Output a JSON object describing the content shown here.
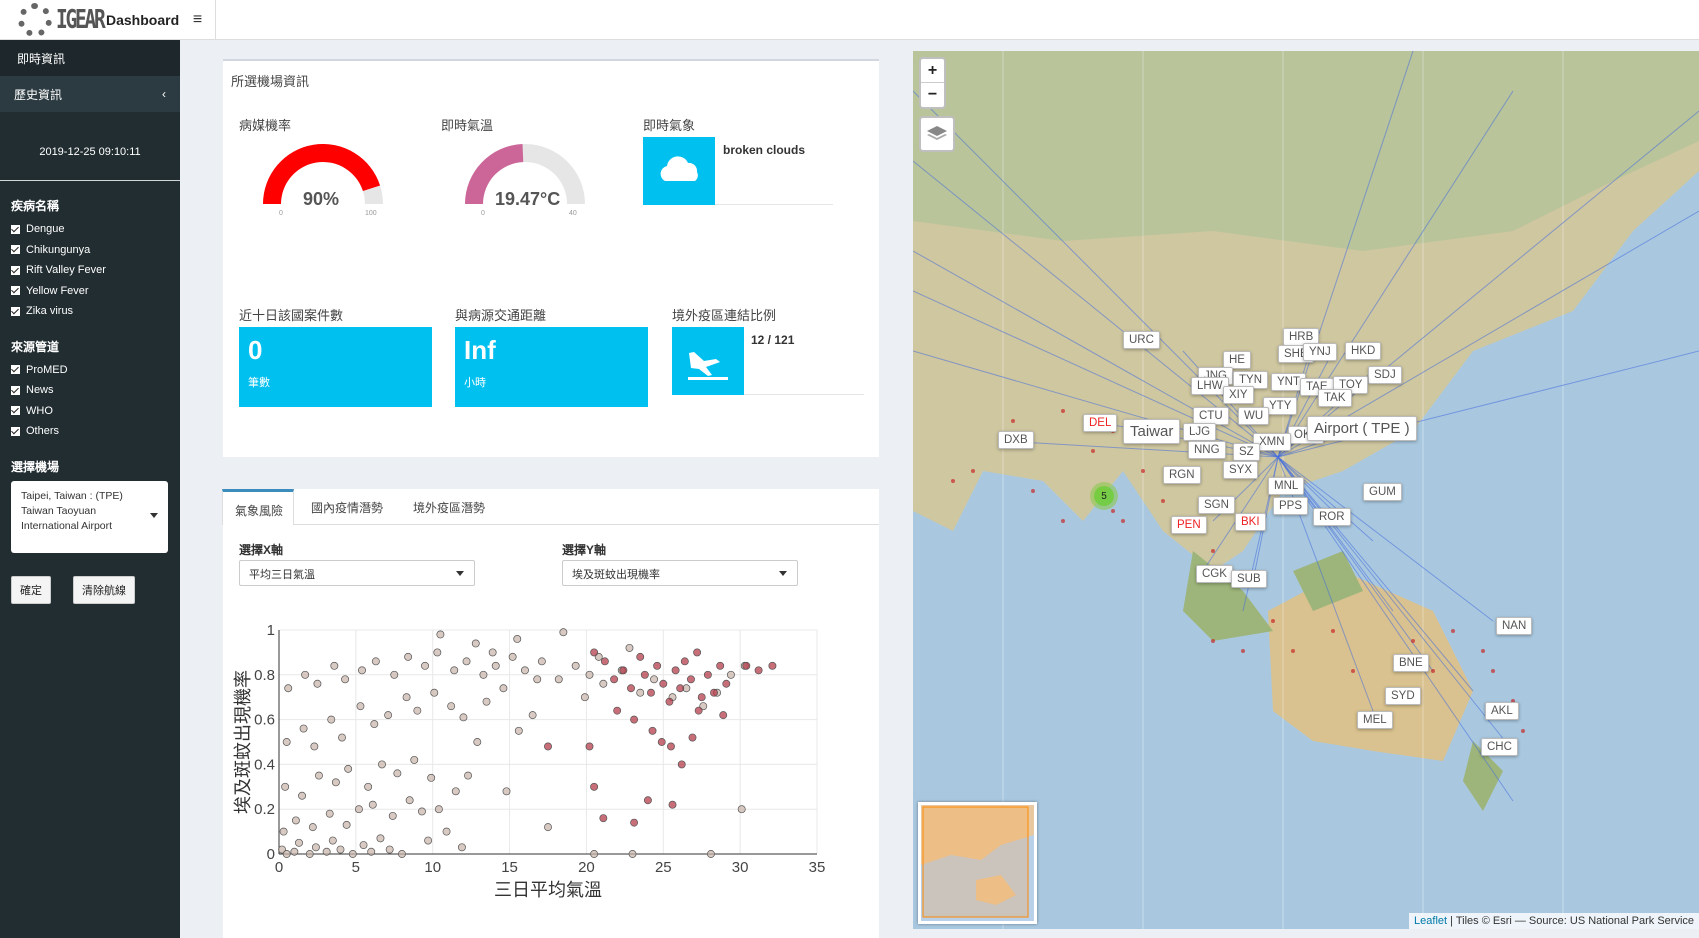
{
  "header": {
    "brand": "IGEAR",
    "title": "Dashboard",
    "menu_icon": "hamburger-icon"
  },
  "sidebar": {
    "nav": [
      {
        "label": "即時資訊"
      },
      {
        "label": "歷史資訊"
      }
    ],
    "datetime": "2019-12-25 09:10:11",
    "disease_title": "疾病名稱",
    "diseases": [
      "Dengue",
      "Chikungunya",
      "Rift Valley Fever",
      "Yellow Fever",
      "Zika virus"
    ],
    "source_title": "來源管道",
    "sources": [
      "ProMED",
      "News",
      "WHO",
      "Others"
    ],
    "airport_title": "選擇機場",
    "airport_value": "Taipei, Taiwan : (TPE) Taiwan Taoyuan International Airport",
    "confirm": "確定",
    "clear": "清除航線"
  },
  "info": {
    "title": "所選機場資訊",
    "prob_label": "病媒機率",
    "prob_value": "90%",
    "prob_fraction": 0.9,
    "prob_min": "0",
    "prob_max": "100",
    "temp_label": "即時氣溫",
    "temp_value": "19.47°C",
    "temp_fraction": 0.4868,
    "temp_min": "0",
    "temp_max": "40",
    "weather_label": "即時氣象",
    "weather_value": "broken clouds",
    "cases_label": "近十日該國案件數",
    "cases_value": "0",
    "cases_unit": "筆數",
    "distance_label": "與病源交通距離",
    "distance_value": "Inf",
    "distance_unit": "小時",
    "ratio_label": "境外疫區連結比例",
    "ratio_value": "12 / 121",
    "colors": {
      "gauge_red": "#ff0000",
      "gauge_pink": "#cc6699",
      "box": "#00c0ef"
    }
  },
  "tabs": [
    "氣象風險",
    "國內疫情潛勢",
    "境外疫區潛勢"
  ],
  "xaxis_label": "選擇X軸",
  "xaxis_value": "平均三日氣溫",
  "yaxis_label": "選擇Y軸",
  "yaxis_value": "埃及斑蚊出現機率",
  "chart_data": {
    "type": "scatter",
    "xlabel": "三日平均氣溫",
    "ylabel": "埃及斑蚊出現機率",
    "xlim": [
      0,
      35
    ],
    "ylim": [
      0,
      1
    ],
    "xticks": [
      "0",
      "5",
      "10",
      "15",
      "20",
      "25",
      "30",
      "35"
    ],
    "yticks": [
      "0",
      "0.2",
      "0.4",
      "0.6",
      "0.8",
      "1"
    ],
    "series": [
      {
        "color": "#c8b4a8",
        "points": [
          [
            0.2,
            0.02
          ],
          [
            0.5,
            0.0
          ],
          [
            1.0,
            0.01
          ],
          [
            1.3,
            0.05
          ],
          [
            2.0,
            0.0
          ],
          [
            2.4,
            0.03
          ],
          [
            3.1,
            0.01
          ],
          [
            3.5,
            0.06
          ],
          [
            4.0,
            0.02
          ],
          [
            4.8,
            0.0
          ],
          [
            5.5,
            0.04
          ],
          [
            6.0,
            0.01
          ],
          [
            6.6,
            0.07
          ],
          [
            7.2,
            0.02
          ],
          [
            8.0,
            0.0
          ],
          [
            0.3,
            0.1
          ],
          [
            1.1,
            0.15
          ],
          [
            2.2,
            0.12
          ],
          [
            3.3,
            0.18
          ],
          [
            4.4,
            0.13
          ],
          [
            5.2,
            0.2
          ],
          [
            6.1,
            0.22
          ],
          [
            7.4,
            0.17
          ],
          [
            8.5,
            0.24
          ],
          [
            9.3,
            0.19
          ],
          [
            0.4,
            0.3
          ],
          [
            1.5,
            0.26
          ],
          [
            2.6,
            0.35
          ],
          [
            3.7,
            0.32
          ],
          [
            4.5,
            0.38
          ],
          [
            5.8,
            0.3
          ],
          [
            6.7,
            0.4
          ],
          [
            7.7,
            0.36
          ],
          [
            8.8,
            0.42
          ],
          [
            9.9,
            0.34
          ],
          [
            10.4,
            0.2
          ],
          [
            11.5,
            0.28
          ],
          [
            12.3,
            0.35
          ],
          [
            0.5,
            0.5
          ],
          [
            1.6,
            0.56
          ],
          [
            2.3,
            0.48
          ],
          [
            3.4,
            0.6
          ],
          [
            4.1,
            0.52
          ],
          [
            5.3,
            0.66
          ],
          [
            6.2,
            0.58
          ],
          [
            7.1,
            0.62
          ],
          [
            8.3,
            0.7
          ],
          [
            9.0,
            0.64
          ],
          [
            10.1,
            0.72
          ],
          [
            11.2,
            0.66
          ],
          [
            12.0,
            0.61
          ],
          [
            13.5,
            0.68
          ],
          [
            14.6,
            0.74
          ],
          [
            0.6,
            0.74
          ],
          [
            1.7,
            0.8
          ],
          [
            2.5,
            0.76
          ],
          [
            3.6,
            0.84
          ],
          [
            4.3,
            0.78
          ],
          [
            5.4,
            0.82
          ],
          [
            6.3,
            0.86
          ],
          [
            7.5,
            0.8
          ],
          [
            8.4,
            0.88
          ],
          [
            9.5,
            0.84
          ],
          [
            10.3,
            0.9
          ],
          [
            11.4,
            0.82
          ],
          [
            12.2,
            0.86
          ],
          [
            13.3,
            0.8
          ],
          [
            14.1,
            0.84
          ],
          [
            15.2,
            0.88
          ],
          [
            16.0,
            0.82
          ],
          [
            17.1,
            0.86
          ],
          [
            18.2,
            0.78
          ],
          [
            19.3,
            0.84
          ],
          [
            20.2,
            0.8
          ],
          [
            21.1,
            0.76
          ],
          [
            22.3,
            0.82
          ],
          [
            23.5,
            0.72
          ],
          [
            24.4,
            0.78
          ],
          [
            25.6,
            0.7
          ],
          [
            26.5,
            0.74
          ],
          [
            27.6,
            0.66
          ],
          [
            28.5,
            0.72
          ],
          [
            29.4,
            0.8
          ],
          [
            30.3,
            0.84
          ],
          [
            15.5,
            0.96
          ],
          [
            10.5,
            0.98
          ],
          [
            18.5,
            0.99
          ],
          [
            12.8,
            0.94
          ],
          [
            13.9,
            0.9
          ],
          [
            16.8,
            0.78
          ],
          [
            19.9,
            0.7
          ],
          [
            20.8,
            0.88
          ],
          [
            22.8,
            0.92
          ],
          [
            17.5,
            0.12
          ],
          [
            10.9,
            0.1
          ],
          [
            14.8,
            0.28
          ],
          [
            12.9,
            0.5
          ],
          [
            15.6,
            0.55
          ],
          [
            16.5,
            0.62
          ],
          [
            9.7,
            0.06
          ],
          [
            11.9,
            0.03
          ],
          [
            20.5,
            0.0
          ],
          [
            23.0,
            0.0
          ],
          [
            28.1,
            0.0
          ],
          [
            30.1,
            0.2
          ]
        ]
      },
      {
        "color": "#b03040",
        "points": [
          [
            20.5,
            0.9
          ],
          [
            21.2,
            0.86
          ],
          [
            21.8,
            0.78
          ],
          [
            22.4,
            0.82
          ],
          [
            22.9,
            0.74
          ],
          [
            23.5,
            0.88
          ],
          [
            23.8,
            0.8
          ],
          [
            24.2,
            0.72
          ],
          [
            24.6,
            0.84
          ],
          [
            25.0,
            0.76
          ],
          [
            25.4,
            0.68
          ],
          [
            25.8,
            0.82
          ],
          [
            26.1,
            0.74
          ],
          [
            26.4,
            0.86
          ],
          [
            26.8,
            0.78
          ],
          [
            27.2,
            0.9
          ],
          [
            27.5,
            0.7
          ],
          [
            27.9,
            0.8
          ],
          [
            28.3,
            0.72
          ],
          [
            28.7,
            0.84
          ],
          [
            29.1,
            0.76
          ],
          [
            30.4,
            0.84
          ],
          [
            31.2,
            0.82
          ],
          [
            32.1,
            0.84
          ],
          [
            23.1,
            0.6
          ],
          [
            24.3,
            0.55
          ],
          [
            25.5,
            0.48
          ],
          [
            26.2,
            0.4
          ],
          [
            22.0,
            0.64
          ],
          [
            24.9,
            0.5
          ],
          [
            20.2,
            0.48
          ],
          [
            17.5,
            0.48
          ],
          [
            24.0,
            0.24
          ],
          [
            25.6,
            0.22
          ],
          [
            23.1,
            0.14
          ],
          [
            21.1,
            0.16
          ],
          [
            20.5,
            0.3
          ],
          [
            26.9,
            0.52
          ],
          [
            27.3,
            0.64
          ],
          [
            28.9,
            0.62
          ]
        ]
      }
    ]
  },
  "map": {
    "zoom_in": "+",
    "zoom_out": "−",
    "focus_label_left": "Taiwar",
    "focus_label_right": "Airport ( TPE )",
    "cluster_count": "5",
    "attribution_link": "Leaflet",
    "attribution_text": "| Tiles © Esri — Source: US National Park Service",
    "airports": [
      {
        "code": "URC",
        "red": false
      },
      {
        "code": "HRB",
        "red": false
      },
      {
        "code": "SHE",
        "red": false
      },
      {
        "code": "YNJ",
        "red": false
      },
      {
        "code": "HKD",
        "red": false
      },
      {
        "code": "SDJ",
        "red": false
      },
      {
        "code": "HE",
        "red": false
      },
      {
        "code": "JNG",
        "red": false
      },
      {
        "code": "TYN",
        "red": false
      },
      {
        "code": "YNT",
        "red": false
      },
      {
        "code": "TAE",
        "red": false
      },
      {
        "code": "TOY",
        "red": false
      },
      {
        "code": "LHW",
        "red": false
      },
      {
        "code": "XIY",
        "red": false
      },
      {
        "code": "TAK",
        "red": false
      },
      {
        "code": "YTY",
        "red": false
      },
      {
        "code": "CTU",
        "red": false
      },
      {
        "code": "WU",
        "red": false
      },
      {
        "code": "DEL",
        "red": true
      },
      {
        "code": "DXB",
        "red": false
      },
      {
        "code": "LJG",
        "red": false
      },
      {
        "code": "OKA",
        "red": false
      },
      {
        "code": "XMN",
        "red": false
      },
      {
        "code": "NNG",
        "red": false
      },
      {
        "code": "SZ",
        "red": false
      },
      {
        "code": "RGN",
        "red": false
      },
      {
        "code": "SYX",
        "red": false
      },
      {
        "code": "MNL",
        "red": false
      },
      {
        "code": "GUM",
        "red": false
      },
      {
        "code": "SGN",
        "red": false
      },
      {
        "code": "PPS",
        "red": false
      },
      {
        "code": "PEN",
        "red": true
      },
      {
        "code": "BKI",
        "red": true
      },
      {
        "code": "ROR",
        "red": false
      },
      {
        "code": "CGK",
        "red": false
      },
      {
        "code": "SUB",
        "red": false
      },
      {
        "code": "NAN",
        "red": false
      },
      {
        "code": "BNE",
        "red": false
      },
      {
        "code": "SYD",
        "red": false
      },
      {
        "code": "MEL",
        "red": false
      },
      {
        "code": "AKL",
        "red": false
      },
      {
        "code": "CHC",
        "red": false
      }
    ]
  }
}
